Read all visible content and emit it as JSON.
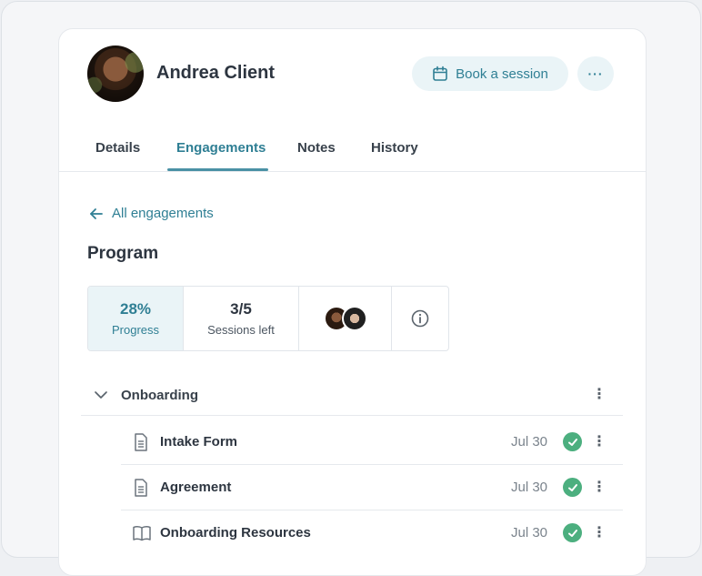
{
  "client": {
    "name": "Andrea Client"
  },
  "header": {
    "book_label": "Book a session"
  },
  "tabs": [
    {
      "label": "Details"
    },
    {
      "label": "Engagements"
    },
    {
      "label": "Notes"
    },
    {
      "label": "History"
    }
  ],
  "back_link": "All engagements",
  "program": {
    "title": "Program",
    "progress_value": "28%",
    "progress_label": "Progress",
    "sessions_value": "3/5",
    "sessions_label": "Sessions left"
  },
  "section": {
    "label": "Onboarding"
  },
  "items": [
    {
      "label": "Intake Form",
      "date": "Jul 30",
      "icon": "document-icon"
    },
    {
      "label": "Agreement",
      "date": "Jul 30",
      "icon": "document-icon"
    },
    {
      "label": "Onboarding Resources",
      "date": "Jul 30",
      "icon": "book-icon"
    }
  ],
  "colors": {
    "accent": "#2f7f94",
    "accent_bg": "#eaf4f7",
    "success": "#4caf7f"
  }
}
